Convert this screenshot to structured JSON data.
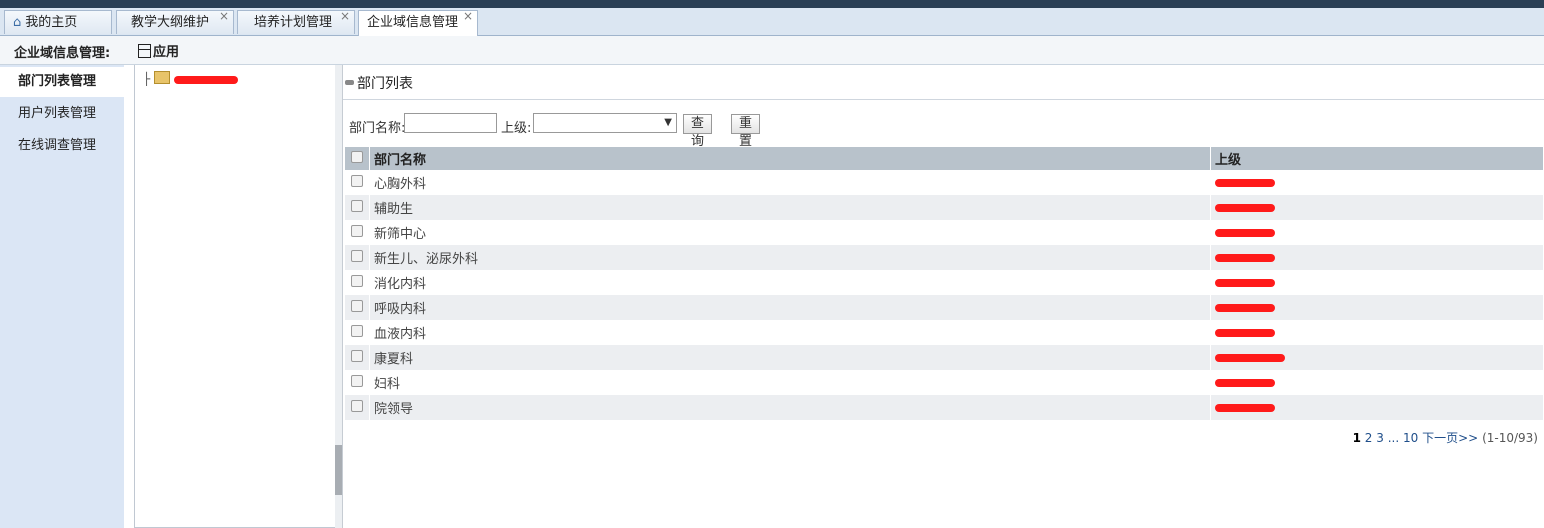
{
  "tabs": [
    {
      "label": "我的主页",
      "closable": false,
      "active": false
    },
    {
      "label": "教学大纲维护",
      "closable": true,
      "active": false
    },
    {
      "label": "培养计划管理",
      "closable": true,
      "active": false
    },
    {
      "label": "企业域信息管理",
      "closable": true,
      "active": true
    }
  ],
  "toolbar": {
    "title": "企业域信息管理:",
    "apply_label": "应用"
  },
  "sidebar": {
    "items": [
      "部门列表管理",
      "用户列表管理",
      "在线调查管理"
    ]
  },
  "tree": {
    "root_label": ""
  },
  "main": {
    "panel_title": "部门列表",
    "search": {
      "name_label": "部门名称:",
      "parent_label": "上级:",
      "query_button": "查询",
      "reset_button": "重置",
      "name_value": "",
      "parent_value": ""
    },
    "table": {
      "columns": [
        "部门名称",
        "上级"
      ],
      "rows": [
        "心胸外科",
        "辅助生",
        "新筛中心",
        "新生儿、泌尿外科",
        "消化内科",
        "呼吸内科",
        "血液内科",
        "康夏科",
        "妇科",
        "院领导"
      ]
    },
    "pager": {
      "current": "1",
      "pages": [
        "2",
        "3"
      ],
      "ellipsis": "...",
      "last": "10",
      "next": "下一页>>",
      "summary": "(1-10/93)"
    }
  },
  "colors": {
    "redaction": "#ff1a1a",
    "header_bg": "#b8c2cb",
    "sidebar_bg": "#dbe6f5"
  }
}
